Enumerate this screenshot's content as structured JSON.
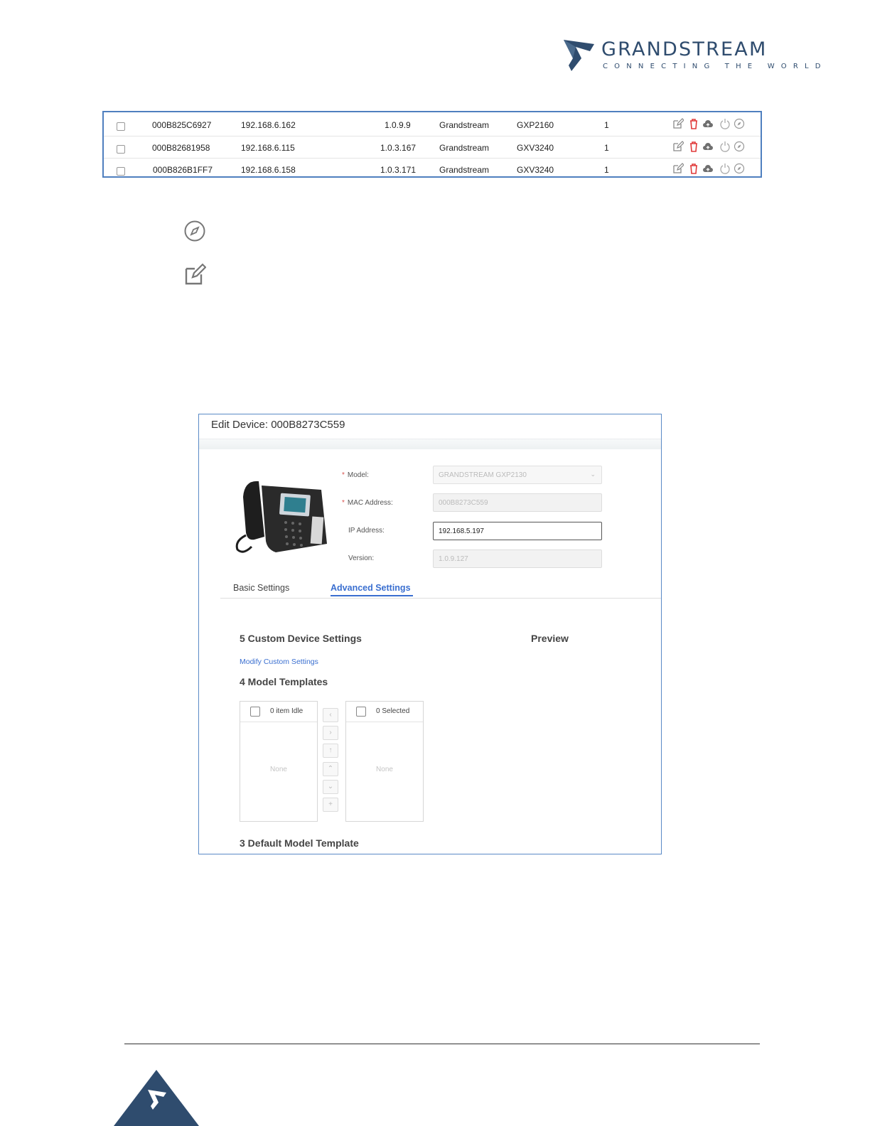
{
  "brand": {
    "name": "GRANDSTREAM",
    "tagline": "CONNECTING THE WORLD",
    "color": "#2f4c6e"
  },
  "devices": [
    {
      "mac": "000B825C6927",
      "ip": "192.168.6.162",
      "version": "1.0.9.9",
      "vendor": "Grandstream",
      "model": "GXP2160",
      "accounts": "1"
    },
    {
      "mac": "000B82681958",
      "ip": "192.168.6.115",
      "version": "1.0.3.167",
      "vendor": "Grandstream",
      "model": "GXV3240",
      "accounts": "1"
    },
    {
      "mac": "000B826B1FF7",
      "ip": "192.168.6.158",
      "version": "1.0.3.171",
      "vendor": "Grandstream",
      "model": "GXV3240",
      "accounts": "1"
    }
  ],
  "row_actions": [
    "edit-icon",
    "delete-icon",
    "cloud-upload-icon",
    "power-icon",
    "compass-icon"
  ],
  "legend_icons": [
    "compass-icon",
    "edit-icon"
  ],
  "edit_device": {
    "title": "Edit Device: 000B8273C559",
    "model_label": "Model:",
    "model_value": "GRANDSTREAM GXP2130",
    "mac_label": "MAC Address:",
    "mac_value": "000B8273C559",
    "ip_label": "IP Address:",
    "ip_value": "192.168.5.197",
    "version_label": "Version:",
    "version_value": "1.0.9.127",
    "tabs": [
      "Basic Settings",
      "Advanced Settings"
    ],
    "active_tab": "Advanced Settings",
    "custom_settings_heading": "5 Custom Device Settings",
    "preview_heading": "Preview",
    "modify_link": "Modify Custom Settings",
    "model_templates_heading": "4 Model Templates",
    "left_list_header": "0 item Idle",
    "right_list_header": "0 Selected",
    "empty_text": "None",
    "transfer_buttons": [
      "‹",
      "›",
      "↑",
      "⌃",
      "⌄",
      "+"
    ],
    "default_template_heading": "3 Default Model Template"
  },
  "accent_color": "#3a6fd0"
}
